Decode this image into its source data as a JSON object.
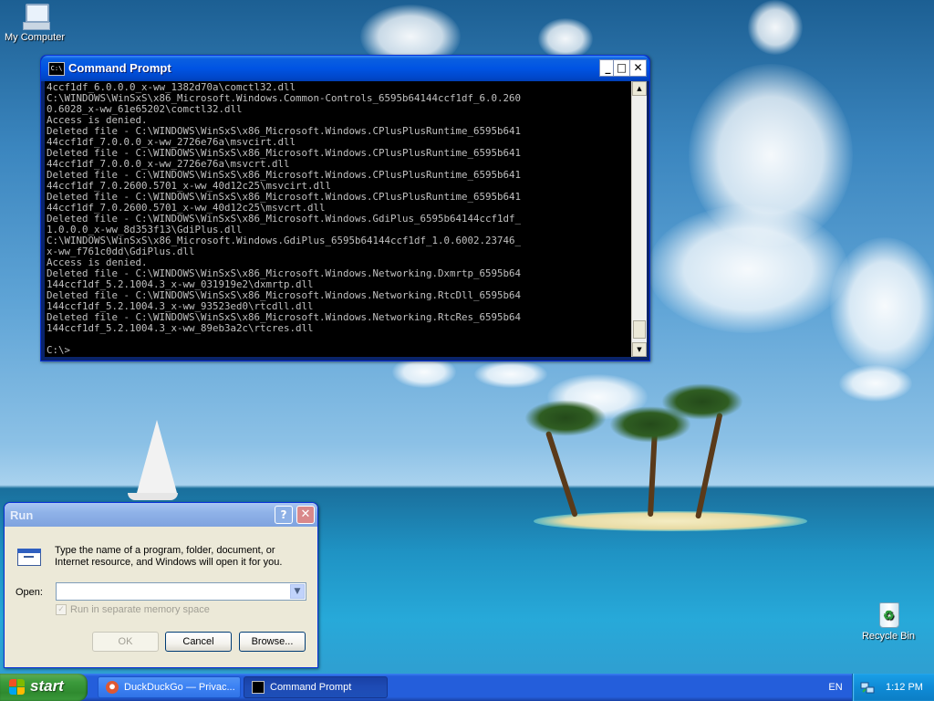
{
  "desktop": {
    "icons": {
      "my_computer": "My Computer",
      "recycle_bin": "Recycle Bin"
    }
  },
  "cmd_window": {
    "title": "Command Prompt",
    "icon_label": "C:\\",
    "buttons": {
      "minimize": "_",
      "maximize": "□",
      "close": "✕"
    },
    "output": "4ccf1df_6.0.0.0_x-ww_1382d70a\\comctl32.dll\nC:\\WINDOWS\\WinSxS\\x86_Microsoft.Windows.Common-Controls_6595b64144ccf1df_6.0.260\n0.6028_x-ww_61e65202\\comctl32.dll\nAccess is denied.\nDeleted file - C:\\WINDOWS\\WinSxS\\x86_Microsoft.Windows.CPlusPlusRuntime_6595b641\n44ccf1df_7.0.0.0_x-ww_2726e76a\\msvcirt.dll\nDeleted file - C:\\WINDOWS\\WinSxS\\x86_Microsoft.Windows.CPlusPlusRuntime_6595b641\n44ccf1df_7.0.0.0_x-ww_2726e76a\\msvcrt.dll\nDeleted file - C:\\WINDOWS\\WinSxS\\x86_Microsoft.Windows.CPlusPlusRuntime_6595b641\n44ccf1df_7.0.2600.5701_x-ww_40d12c25\\msvcirt.dll\nDeleted file - C:\\WINDOWS\\WinSxS\\x86_Microsoft.Windows.CPlusPlusRuntime_6595b641\n44ccf1df_7.0.2600.5701_x-ww_40d12c25\\msvcrt.dll\nDeleted file - C:\\WINDOWS\\WinSxS\\x86_Microsoft.Windows.GdiPlus_6595b64144ccf1df_\n1.0.0.0_x-ww_8d353f13\\GdiPlus.dll\nC:\\WINDOWS\\WinSxS\\x86_Microsoft.Windows.GdiPlus_6595b64144ccf1df_1.0.6002.23746_\nx-ww_f761c0dd\\GdiPlus.dll\nAccess is denied.\nDeleted file - C:\\WINDOWS\\WinSxS\\x86_Microsoft.Windows.Networking.Dxmrtp_6595b64\n144ccf1df_5.2.1004.3_x-ww_031919e2\\dxmrtp.dll\nDeleted file - C:\\WINDOWS\\WinSxS\\x86_Microsoft.Windows.Networking.RtcDll_6595b64\n144ccf1df_5.2.1004.3_x-ww_93523ed0\\rtcdll.dll\nDeleted file - C:\\WINDOWS\\WinSxS\\x86_Microsoft.Windows.Networking.RtcRes_6595b64\n144ccf1df_5.2.1004.3_x-ww_89eb3a2c\\rtcres.dll\n\nC:\\>",
    "scroll": {
      "up": "▲",
      "down": "▼"
    }
  },
  "run_dialog": {
    "title": "Run",
    "help": "?",
    "close": "✕",
    "description": "Type the name of a program, folder, document, or Internet resource, and Windows will open it for you.",
    "open_label": "Open:",
    "open_value": "",
    "dropdown_arrow": "▼",
    "checkbox_mark": "✓",
    "checkbox_label": "Run in separate memory space",
    "buttons": {
      "ok": "OK",
      "cancel": "Cancel",
      "browse": "Browse..."
    }
  },
  "taskbar": {
    "start": "start",
    "tasks": [
      {
        "label": "DuckDuckGo — Privac...",
        "active": false
      },
      {
        "label": "Command Prompt",
        "active": true
      }
    ],
    "language": "EN",
    "clock": "1:12 PM"
  }
}
